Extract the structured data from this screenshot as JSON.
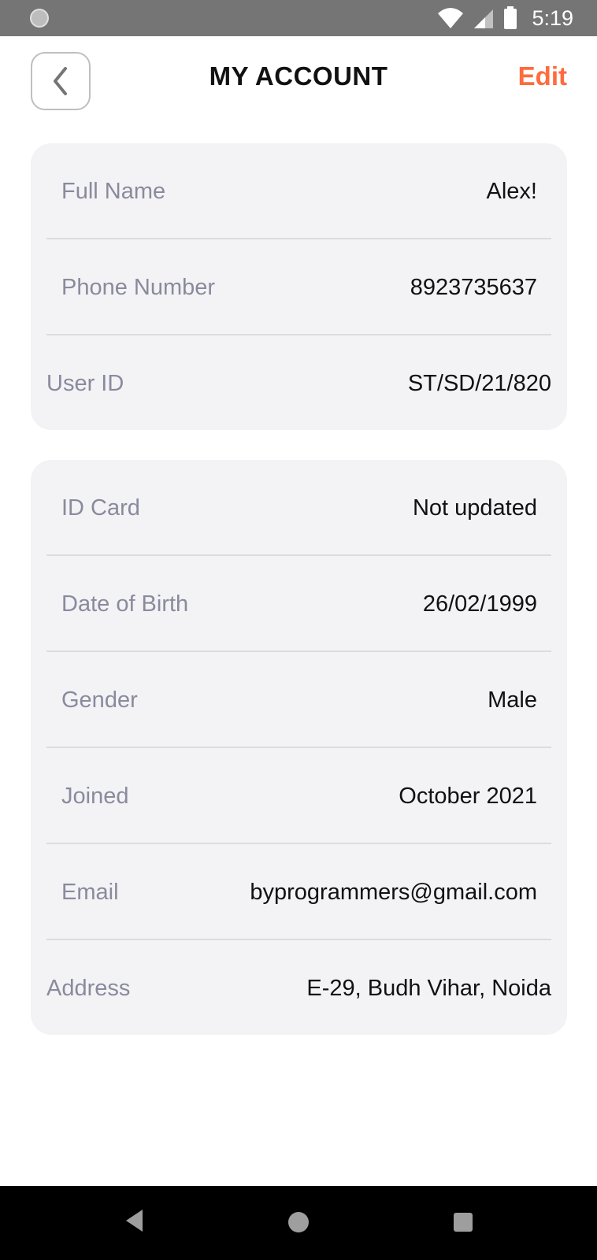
{
  "status_bar": {
    "time": "5:19"
  },
  "header": {
    "title": "MY ACCOUNT",
    "edit_label": "Edit"
  },
  "personal": {
    "full_name": {
      "label": "Full Name",
      "value": "Alex!"
    },
    "phone": {
      "label": "Phone Number",
      "value": "8923735637"
    },
    "user_id": {
      "label": "User ID",
      "value": "ST/SD/21/820"
    }
  },
  "details": {
    "id_card": {
      "label": "ID Card",
      "value": "Not updated"
    },
    "dob": {
      "label": "Date of Birth",
      "value": "26/02/1999"
    },
    "gender": {
      "label": "Gender",
      "value": "Male"
    },
    "joined": {
      "label": "Joined",
      "value": "October 2021"
    },
    "email": {
      "label": "Email",
      "value": "byprogrammers@gmail.com"
    },
    "address": {
      "label": "Address",
      "value": "E-29, Budh Vihar, Noida"
    }
  },
  "colors": {
    "accent": "#ff6b3d",
    "card_bg": "#f3f3f5",
    "label": "#8a8a9e"
  },
  "icons": [
    "notification-icon",
    "wifi-icon",
    "signal-icon",
    "battery-icon",
    "chevron-left-icon",
    "nav-back-icon",
    "nav-home-icon",
    "nav-recent-icon"
  ]
}
